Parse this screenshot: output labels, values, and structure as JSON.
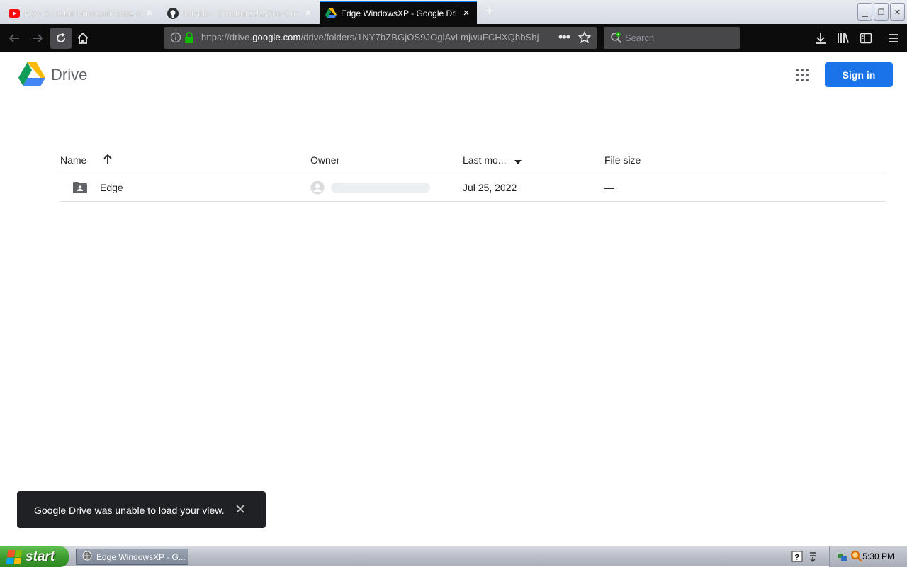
{
  "browser": {
    "tabs": [
      {
        "title": "How to install Microsoft Edge on W",
        "favicon": "youtube-icon",
        "active": false
      },
      {
        "title": "GitHub - Skulltrail192/One-Core-A",
        "favicon": "github-icon",
        "active": false
      },
      {
        "title": "Edge WindowsXP - Google Drive",
        "favicon": "google-drive-icon",
        "active": true
      }
    ],
    "url": {
      "prefix": "https://drive.",
      "host": "google.com",
      "path": "/drive/folders/1NY7bZBGjOS9JOglAvLmjwuFCHXQhbShj"
    },
    "search_placeholder": "Search"
  },
  "drive": {
    "title": "Drive",
    "sign_in_label": "Sign in",
    "columns": {
      "name": "Name",
      "owner": "Owner",
      "last_modified": "Last mo...",
      "file_size": "File size"
    },
    "files": [
      {
        "name": "Edge",
        "modified": "Jul 25, 2022",
        "size": "—"
      }
    ],
    "toast": "Google Drive was unable to load your view."
  },
  "taskbar": {
    "start_label": "start",
    "task_title": "Edge WindowsXP - G...",
    "clock": "5:30 PM"
  },
  "colors": {
    "accent": "#1a73e8",
    "tab_active_bg": "#0c0c0d",
    "toast_bg": "#202124"
  }
}
